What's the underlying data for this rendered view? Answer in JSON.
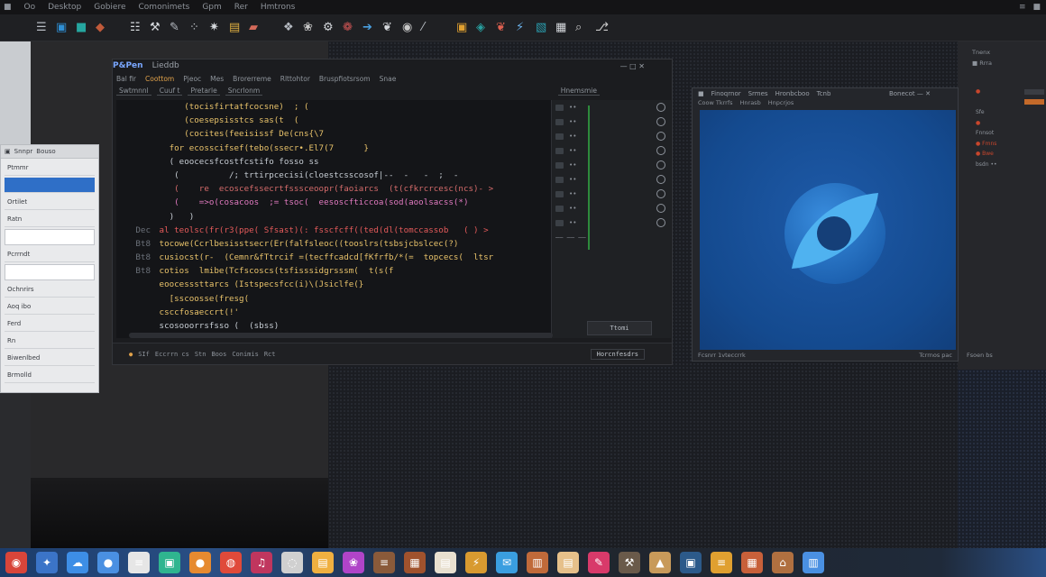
{
  "menubar": {
    "items": [
      "■",
      "Oo",
      "Desktop",
      "Gobiere",
      "Comonimets",
      "Gpm",
      "Rer",
      "Hmtrons"
    ],
    "right_items": [
      "≡",
      "■"
    ]
  },
  "toolbar": {
    "icons": [
      {
        "name": "code-icon",
        "glyph": "☰",
        "color": "#b7bcc3"
      },
      {
        "name": "folder-icon",
        "glyph": "▣",
        "color": "#2f8fd4"
      },
      {
        "name": "paint-icon",
        "glyph": "■",
        "color": "#26a6a0"
      },
      {
        "name": "tag-icon",
        "glyph": "◆",
        "color": "#c05a3a"
      },
      {
        "name": "grid-icon",
        "glyph": "☷",
        "color": "#d5d8dc"
      },
      {
        "name": "wrench-icon",
        "glyph": "⚒",
        "color": "#d5d8dc"
      },
      {
        "name": "pen-icon",
        "glyph": "✎",
        "color": "#b7bcc3"
      },
      {
        "name": "brush-icon",
        "glyph": "⁘",
        "color": "#c4c8cd"
      },
      {
        "name": "star-icon",
        "glyph": "✷",
        "color": "#d5d8dc"
      },
      {
        "name": "layers-icon",
        "glyph": "▤",
        "color": "#e0b040"
      },
      {
        "name": "car-icon",
        "glyph": "▰",
        "color": "#d46a5a"
      },
      {
        "name": "share-icon",
        "glyph": "❖",
        "color": "#b7bcc3"
      },
      {
        "name": "palette-icon",
        "glyph": "❀",
        "color": "#c8c8c8"
      },
      {
        "name": "gear-icon",
        "glyph": "⚙",
        "color": "#d5d8dc"
      },
      {
        "name": "link-icon",
        "glyph": "❁",
        "color": "#d05555"
      },
      {
        "name": "cursor-icon",
        "glyph": "➔",
        "color": "#4aa0e0"
      },
      {
        "name": "filter-icon",
        "glyph": "❦",
        "color": "#d5d8dc"
      },
      {
        "name": "eye-icon",
        "glyph": "◉",
        "color": "#c8c8c8"
      },
      {
        "name": "pencil-icon",
        "glyph": "⁄",
        "color": "#b7bcc3"
      },
      {
        "name": "box-icon",
        "glyph": "▣",
        "color": "#e0a030"
      },
      {
        "name": "shield-icon",
        "glyph": "◈",
        "color": "#28a0a0"
      },
      {
        "name": "bucket-icon",
        "glyph": "❦",
        "color": "#e06050"
      },
      {
        "name": "bolt-icon",
        "glyph": "⚡",
        "color": "#6ab0e8"
      },
      {
        "name": "cube-icon",
        "glyph": "▧",
        "color": "#2a9fb0"
      },
      {
        "name": "frame-icon",
        "glyph": "▦",
        "color": "#d5d8dc"
      },
      {
        "name": "search-icon",
        "glyph": "⌕",
        "color": "#c8c8c8"
      },
      {
        "name": "branch-icon",
        "glyph": "⎇",
        "color": "#c8c8c8"
      }
    ]
  },
  "dialog": {
    "header": [
      "▣",
      "Snnpr",
      "Bouso"
    ],
    "rows": [
      {
        "label": "Ptmmr",
        "state": "normal"
      },
      {
        "label": "",
        "state": "selected"
      },
      {
        "label": "Ortilet",
        "state": "normal"
      },
      {
        "label": "Ratn",
        "state": "normal"
      },
      {
        "label": "",
        "state": "field"
      },
      {
        "label": "Pcrrndt",
        "state": "normal"
      },
      {
        "label": "",
        "state": "field"
      },
      {
        "label": "Ochnrirs",
        "state": "normal"
      },
      {
        "label": "Aoq ibo",
        "state": "normal"
      },
      {
        "label": "Ferd",
        "state": "normal"
      },
      {
        "label": "Rn",
        "state": "normal"
      },
      {
        "label": "Biwenlbed",
        "state": "normal"
      },
      {
        "label": "Brmolld",
        "state": "normal"
      }
    ]
  },
  "editor": {
    "app_name": "P&Pen",
    "title": "Lieddb",
    "window_controls": "—  □  ✕",
    "menu": [
      "Bal fir",
      "Coottom",
      "Pjeoc",
      "Mes",
      "Brorerreme",
      "Rlttohtor",
      "Bruspfiotsrsom",
      "Snae"
    ],
    "menu_active_index": 1,
    "tabs": [
      "Swtmnnl",
      "Cuuf t",
      "Pretarle",
      "Sncrlonm"
    ],
    "tab_right": "Hnemsmie",
    "gutter": [
      "",
      "",
      "",
      "",
      "",
      "",
      "",
      "",
      "",
      "Dec",
      "Bt8",
      "Bt8",
      "Bt8",
      "",
      "",
      ""
    ],
    "code_lines": [
      {
        "text": "      (tocisfirtatfcocsne)  ; (",
        "color": "#e8c26a"
      },
      {
        "text": "      (coesepsisstcs sas(t  (",
        "color": "#e8c26a"
      },
      {
        "text": "      (cocites(feeisissf De(cns{\\7",
        "color": "#e8c26a"
      },
      {
        "text": "   for ecosscifsef(tebo(ssecr•.El7(7      }",
        "color": "#e8c26a"
      },
      {
        "text": "   ( eoocecsfcostfcstifo fosso ss",
        "color": "#c7cdd4"
      },
      {
        "text": "    (          /; trtirpcecisi(cloestcsscosof|--  -   -  ;  -",
        "color": "#c7cdd4"
      },
      {
        "text": "    (    re  ecoscefssecrtfsssceoopr(faoiarcs  (t(cfkrcrcesc(ncs)- >",
        "color": "#d56b6b"
      },
      {
        "text": "    (    =>o(cosacoos  ;= tsoc(  eesoscfticcoa(sod(aoolsacss(*)",
        "color": "#e17ac0"
      },
      {
        "text": "   )   )",
        "color": "#c7cdd4"
      },
      {
        "text": " al teolsc(fr(r3(ppe( Sfsast)(: fsscfcff((ted(dl(tomccassob   ( ) >",
        "color": "#e45a5a"
      },
      {
        "text": " tocowe(Ccrlbesisstsecr(Er(falfsleoc((tooslrs(tsbsjcbslcec(?)",
        "color": "#e8c26a"
      },
      {
        "text": " cusiocst(r-  (Cemnr&fTtrcif =(tecffcadcd[fKfrfb/*(=  topcecs(  ltsr",
        "color": "#e8c26a"
      },
      {
        "text": " cotios  lmibe(Tcfscoscs(tsfisssidgrsssm(  t(s(f",
        "color": "#e8c26a"
      },
      {
        "text": " eoocesssttarcs (Istspecsfcc(i)\\(Jsiclfe(}",
        "color": "#e8c26a"
      },
      {
        "text": "   [sscoosse(fresg(",
        "color": "#e8c26a"
      },
      {
        "text": " csccfosaeccrt(!'",
        "color": "#e8c26a"
      },
      {
        "text": " scosooorrsfsso (  (sbss)",
        "color": "#c7cdd4"
      }
    ],
    "panel_rows": [
      "••",
      "••",
      "••",
      "••",
      "••",
      "••",
      "••",
      "••",
      "••"
    ],
    "panel_bottom": "—— —— ——",
    "term_button": "Ttomi",
    "status_items": [
      "●",
      "SIf",
      "Eccrrn cs",
      "Stn",
      "Boos",
      "Conimis",
      "Rct"
    ],
    "status_button": "Horcnfesdrs"
  },
  "preview": {
    "title_items": [
      "■",
      "Finoqrnor",
      "Srmes",
      "Hronbcboo",
      "Tcnb"
    ],
    "title_right": "Bonecot  —  ✕",
    "menu": [
      "Coow Tkrrfs",
      "Hnrasb",
      "Hnpcrjos"
    ],
    "status_left": "Fcsnrr 1vteccrrk",
    "status_right": "Tcrrnos pac",
    "canvas_color": "#1a57a5"
  },
  "right_column": {
    "head": [
      "Tnenx",
      "■ Rrra"
    ],
    "list": [
      {
        "label": "●",
        "box": "normal"
      },
      {
        "label": "",
        "box": "orange"
      },
      {
        "label": "Sfe",
        "box": "none"
      },
      {
        "label": "●",
        "box": "none"
      },
      {
        "label": "Fnnsot",
        "box": "none"
      },
      {
        "label": "● Fmns",
        "box": "none"
      },
      {
        "label": "● Bwe",
        "box": "none"
      },
      {
        "label": "bsdn  ••",
        "box": "none"
      }
    ],
    "bottom_label": "Fsoen bs"
  },
  "dock": {
    "apps": [
      {
        "name": "photos-app-icon",
        "color": "#d8453a",
        "glyph": "◉"
      },
      {
        "name": "blender-app-icon",
        "color": "#3b74c8",
        "glyph": "✦"
      },
      {
        "name": "cloud-app-icon",
        "color": "#3d8ee6",
        "glyph": "☁"
      },
      {
        "name": "chat-app-icon",
        "color": "#4a90e2",
        "glyph": "●"
      },
      {
        "name": "notes-app-icon",
        "color": "#e6e6e6",
        "glyph": "≡"
      },
      {
        "name": "store-app-icon",
        "color": "#2fb58f",
        "glyph": "▣"
      },
      {
        "name": "record-app-icon",
        "color": "#e68a30",
        "glyph": "●"
      },
      {
        "name": "chrome-app-icon",
        "color": "#e04a3a",
        "glyph": "◍"
      },
      {
        "name": "music-app-icon",
        "color": "#c0365e",
        "glyph": "♫"
      },
      {
        "name": "globe-app-icon",
        "color": "#d0d0d0",
        "glyph": "◌"
      },
      {
        "name": "folder-app-icon",
        "color": "#f0b040",
        "glyph": "▤"
      },
      {
        "name": "palette-app-icon",
        "color": "#b044c8",
        "glyph": "❀"
      },
      {
        "name": "bars-app-icon",
        "color": "#8a5a3a",
        "glyph": "≡"
      },
      {
        "name": "grid-app-icon",
        "color": "#a0522d",
        "glyph": "▦"
      },
      {
        "name": "docs-app-icon",
        "color": "#e8e0d0",
        "glyph": "▤"
      },
      {
        "name": "bolt-app-icon",
        "color": "#d89a30",
        "glyph": "⚡"
      },
      {
        "name": "mail-app-icon",
        "color": "#3a9ee0",
        "glyph": "✉"
      },
      {
        "name": "book-app-icon",
        "color": "#c06a3a",
        "glyph": "▥"
      },
      {
        "name": "paper-app-icon",
        "color": "#e6c08a",
        "glyph": "▤"
      },
      {
        "name": "pen-app-icon",
        "color": "#d83a6a",
        "glyph": "✎"
      },
      {
        "name": "tools-app-icon",
        "color": "#6a5a4a",
        "glyph": "⚒"
      },
      {
        "name": "mask-app-icon",
        "color": "#c89a5a",
        "glyph": "▲"
      },
      {
        "name": "device-app-icon",
        "color": "#2c5a8a",
        "glyph": "▣"
      },
      {
        "name": "stack-app-icon",
        "color": "#e0a030",
        "glyph": "≡"
      },
      {
        "name": "box-app-icon",
        "color": "#c8603a",
        "glyph": "▦"
      },
      {
        "name": "chair-app-icon",
        "color": "#b07040",
        "glyph": "⌂"
      },
      {
        "name": "trash-app-icon",
        "color": "#4a90e2",
        "glyph": "▥"
      }
    ]
  }
}
